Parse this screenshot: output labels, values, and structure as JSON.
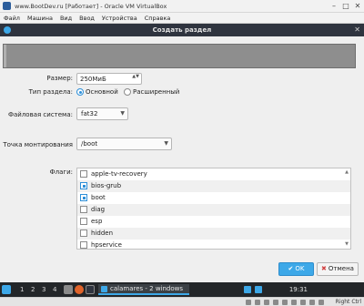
{
  "vbox": {
    "title": "www.BootDev.ru [Работает] - Oracle VM VirtualBox",
    "window_buttons": [
      "–",
      "□",
      "✕"
    ],
    "menu": [
      "Файл",
      "Машина",
      "Вид",
      "Ввод",
      "Устройства",
      "Справка"
    ],
    "status_text": "Right Ctrl"
  },
  "dialog": {
    "title": "Создать раздел",
    "close_glyph": "✕",
    "size_label": "Размер:",
    "size_value": "250МиБ",
    "spin_arrows": "▲▼",
    "type_label": "Тип раздела:",
    "type_primary": "Основной",
    "type_extended": "Расширенный",
    "type_selected": "primary",
    "fs_label": "Файловая система:",
    "fs_value": "fat32",
    "mount_label": "Точка монтирования",
    "mount_value": "/boot",
    "flags_label": "Флаги:",
    "flags": [
      {
        "label": "apple-tv-recovery",
        "checked": false
      },
      {
        "label": "bios-grub",
        "checked": true
      },
      {
        "label": "boot",
        "checked": true
      },
      {
        "label": "diag",
        "checked": false
      },
      {
        "label": "esp",
        "checked": false
      },
      {
        "label": "hidden",
        "checked": false
      },
      {
        "label": "hpservice",
        "checked": false
      }
    ],
    "ok_icon": "✔",
    "ok_label": "OK",
    "cancel_icon": "✖",
    "cancel_label": "Отмена"
  },
  "taskbar": {
    "workspaces": [
      "1",
      "2",
      "3",
      "4"
    ],
    "task_label": "calamares - 2 windows",
    "clock": "19:31"
  },
  "colors": {
    "accent": "#3da8e8",
    "dialog_title_bg": "#2f343f",
    "taskbar_bg": "#232629"
  }
}
